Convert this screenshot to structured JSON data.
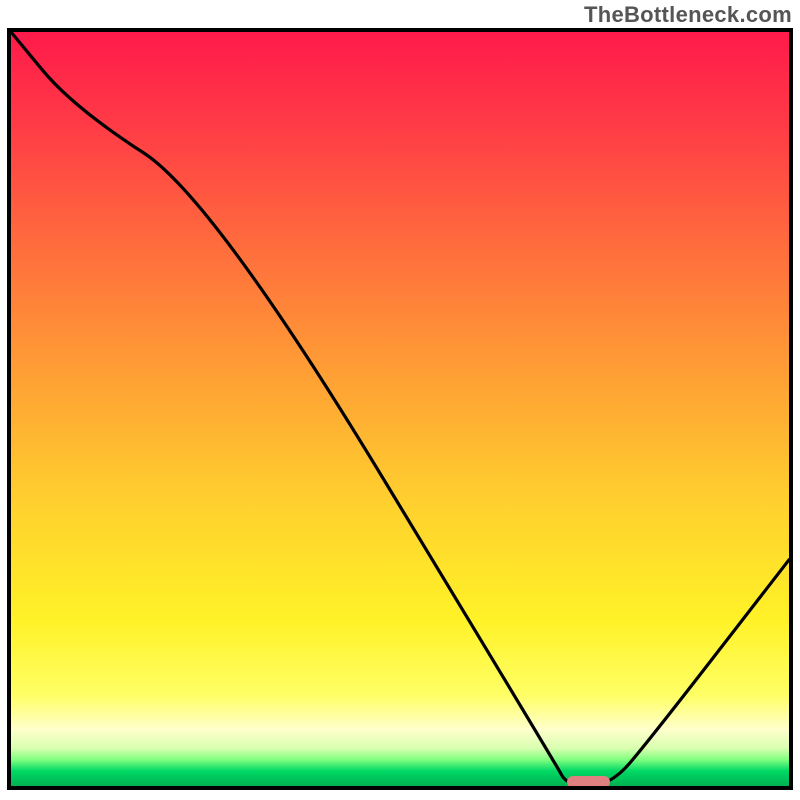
{
  "watermark": "TheBottleneck.com",
  "chart_data": {
    "type": "line",
    "x": [
      0,
      8,
      26,
      70,
      71.5,
      77,
      82,
      100
    ],
    "values": [
      100,
      90,
      78,
      3,
      0,
      0,
      6,
      30
    ],
    "title": "",
    "xlabel": "",
    "ylabel": "",
    "xlim": [
      0,
      100
    ],
    "ylim": [
      0,
      100
    ],
    "marker_segment": {
      "x_start": 71.5,
      "x_end": 77,
      "y": 0
    },
    "gradient_stops": [
      {
        "pos": 0,
        "color": "#ff1a4b"
      },
      {
        "pos": 50,
        "color": "#ffb030"
      },
      {
        "pos": 80,
        "color": "#ffff40"
      },
      {
        "pos": 96,
        "color": "#d0ffb0"
      },
      {
        "pos": 100,
        "color": "#00b050"
      }
    ]
  }
}
